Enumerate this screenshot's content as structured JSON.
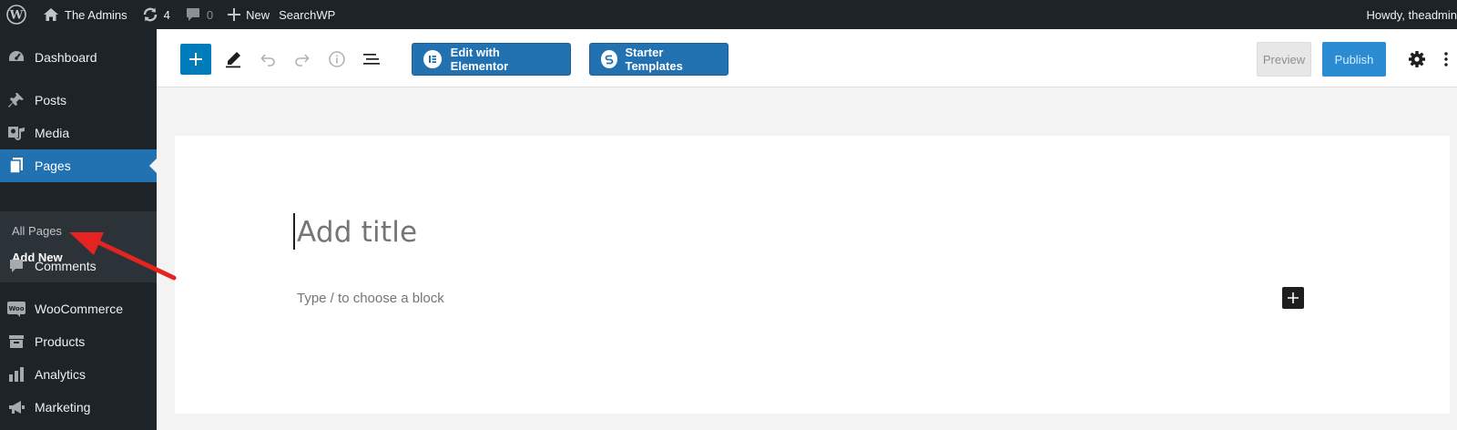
{
  "admin_bar": {
    "site_name": "The Admins",
    "updates_count": "4",
    "comments_count": "0",
    "new_label": "New",
    "searchwp_label": "SearchWP",
    "howdy": "Howdy, theadmin"
  },
  "sidebar": {
    "items": [
      {
        "label": "Dashboard",
        "icon": "dashboard-icon"
      },
      {
        "label": "Posts",
        "icon": "pin-icon"
      },
      {
        "label": "Media",
        "icon": "media-icon"
      },
      {
        "label": "Pages",
        "icon": "pages-icon"
      },
      {
        "label": "Comments",
        "icon": "comment-icon"
      },
      {
        "label": "WooCommerce",
        "icon": "woo-icon"
      },
      {
        "label": "Products",
        "icon": "archive-icon"
      },
      {
        "label": "Analytics",
        "icon": "bar-chart-icon"
      },
      {
        "label": "Marketing",
        "icon": "megaphone-icon"
      }
    ],
    "submenu": [
      "All Pages",
      "Add New"
    ],
    "active_item": "Pages",
    "current_subitem": "Add New"
  },
  "toolbar": {
    "elementor_label": "Edit with Elementor",
    "starter_label": "Starter Templates",
    "preview_label": "Preview",
    "publish_label": "Publish"
  },
  "editor": {
    "title_placeholder": "Add title",
    "block_placeholder": "Type / to choose a block"
  },
  "colors": {
    "admin_dark": "#1d2327",
    "accent_blue": "#2271b1",
    "publish_blue": "#2b8cd4",
    "annotation_arrow": "#e52421"
  }
}
